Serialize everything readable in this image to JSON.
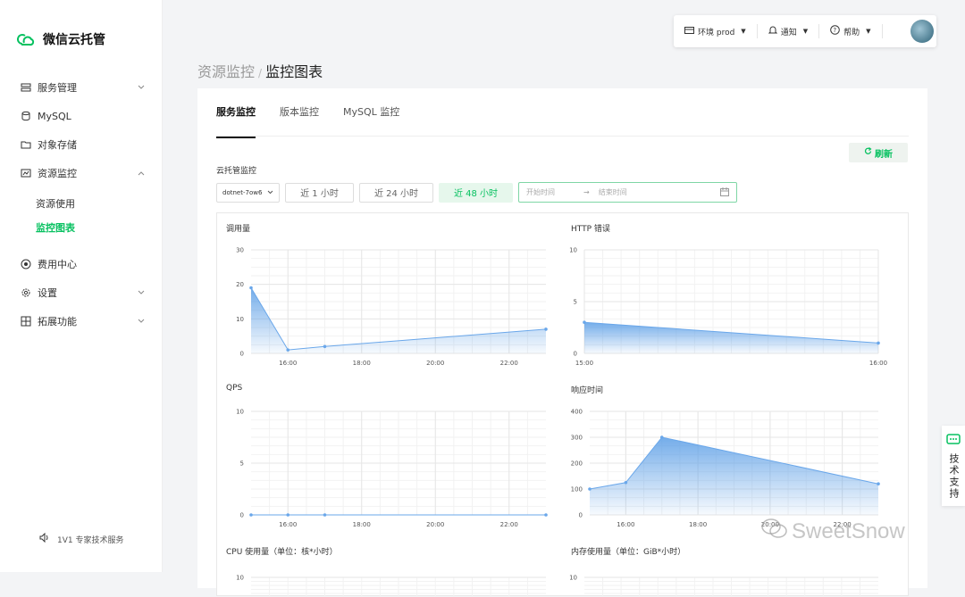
{
  "brand": {
    "name": "微信云托管",
    "color": "#07c160"
  },
  "sidebar": {
    "items": [
      {
        "label": "服务管理",
        "icon": "server-icon",
        "expandable": true,
        "expanded": false
      },
      {
        "label": "MySQL",
        "icon": "database-icon",
        "expandable": false
      },
      {
        "label": "对象存储",
        "icon": "folder-icon",
        "expandable": false
      },
      {
        "label": "资源监控",
        "icon": "monitor-icon",
        "expandable": true,
        "expanded": true
      },
      {
        "label": "费用中心",
        "icon": "billing-icon",
        "expandable": false
      },
      {
        "label": "设置",
        "icon": "gear-icon",
        "expandable": true,
        "expanded": false
      },
      {
        "label": "拓展功能",
        "icon": "grid-icon",
        "expandable": true,
        "expanded": false
      }
    ],
    "subitems": [
      {
        "label": "资源使用",
        "active": false
      },
      {
        "label": "监控图表",
        "active": true
      }
    ],
    "footer": "1V1 专家技术服务"
  },
  "topbar": {
    "env": "环境 prod",
    "notify": "通知",
    "help": "帮助"
  },
  "breadcrumb": {
    "parent": "资源监控",
    "current": "监控图表"
  },
  "tabs": [
    {
      "label": "服务监控",
      "active": true
    },
    {
      "label": "版本监控",
      "active": false
    },
    {
      "label": "MySQL 监控",
      "active": false
    }
  ],
  "toolbar": {
    "refresh": "刷新"
  },
  "section_label": "云托管监控",
  "filters": {
    "service": "dotnet-7ow6",
    "ranges": [
      {
        "label": "近 1 小时",
        "active": false
      },
      {
        "label": "近 24 小时",
        "active": false
      },
      {
        "label": "近 48 小时",
        "active": true
      }
    ],
    "start_placeholder": "开始时间",
    "end_placeholder": "结束时间"
  },
  "support": "技术支持",
  "watermark": "SweetSnow",
  "chart_data": [
    {
      "type": "area",
      "title": "调用量",
      "x": [
        "15:00",
        "16:00",
        "17:00",
        "23:00"
      ],
      "y": [
        19,
        1,
        2,
        7
      ],
      "xticks": [
        "16:00",
        "18:00",
        "20:00",
        "22:00"
      ],
      "yticks": [
        "0",
        "10",
        "20",
        "30"
      ],
      "ylim": [
        0,
        30
      ]
    },
    {
      "type": "area",
      "title": "HTTP 错误",
      "x": [
        "15:00",
        "16:00"
      ],
      "y": [
        3,
        1
      ],
      "xticks": [
        "15:00",
        "16:00"
      ],
      "yticks": [
        "0",
        "5",
        "10"
      ],
      "ylim": [
        0,
        10
      ]
    },
    {
      "type": "area",
      "title": "QPS",
      "x": [
        "15:00",
        "16:00",
        "17:00",
        "23:00"
      ],
      "y": [
        0,
        0,
        0,
        0
      ],
      "xticks": [
        "16:00",
        "18:00",
        "20:00",
        "22:00"
      ],
      "yticks": [
        "0",
        "5",
        "10"
      ],
      "ylim": [
        0,
        10
      ]
    },
    {
      "type": "area",
      "title": "响应时间",
      "x": [
        "15:00",
        "16:00",
        "17:00",
        "23:00"
      ],
      "y": [
        100,
        125,
        300,
        120
      ],
      "xticks": [
        "16:00",
        "18:00",
        "20:00",
        "22:00"
      ],
      "yticks": [
        "0",
        "100",
        "200",
        "300",
        "400"
      ],
      "ylim": [
        0,
        400
      ]
    },
    {
      "type": "area",
      "title": "CPU 使用量（单位：核*小时）",
      "yticks": [
        "10"
      ]
    },
    {
      "type": "area",
      "title": "内存使用量（单位：GiB*小时）",
      "yticks": [
        "10"
      ]
    }
  ]
}
